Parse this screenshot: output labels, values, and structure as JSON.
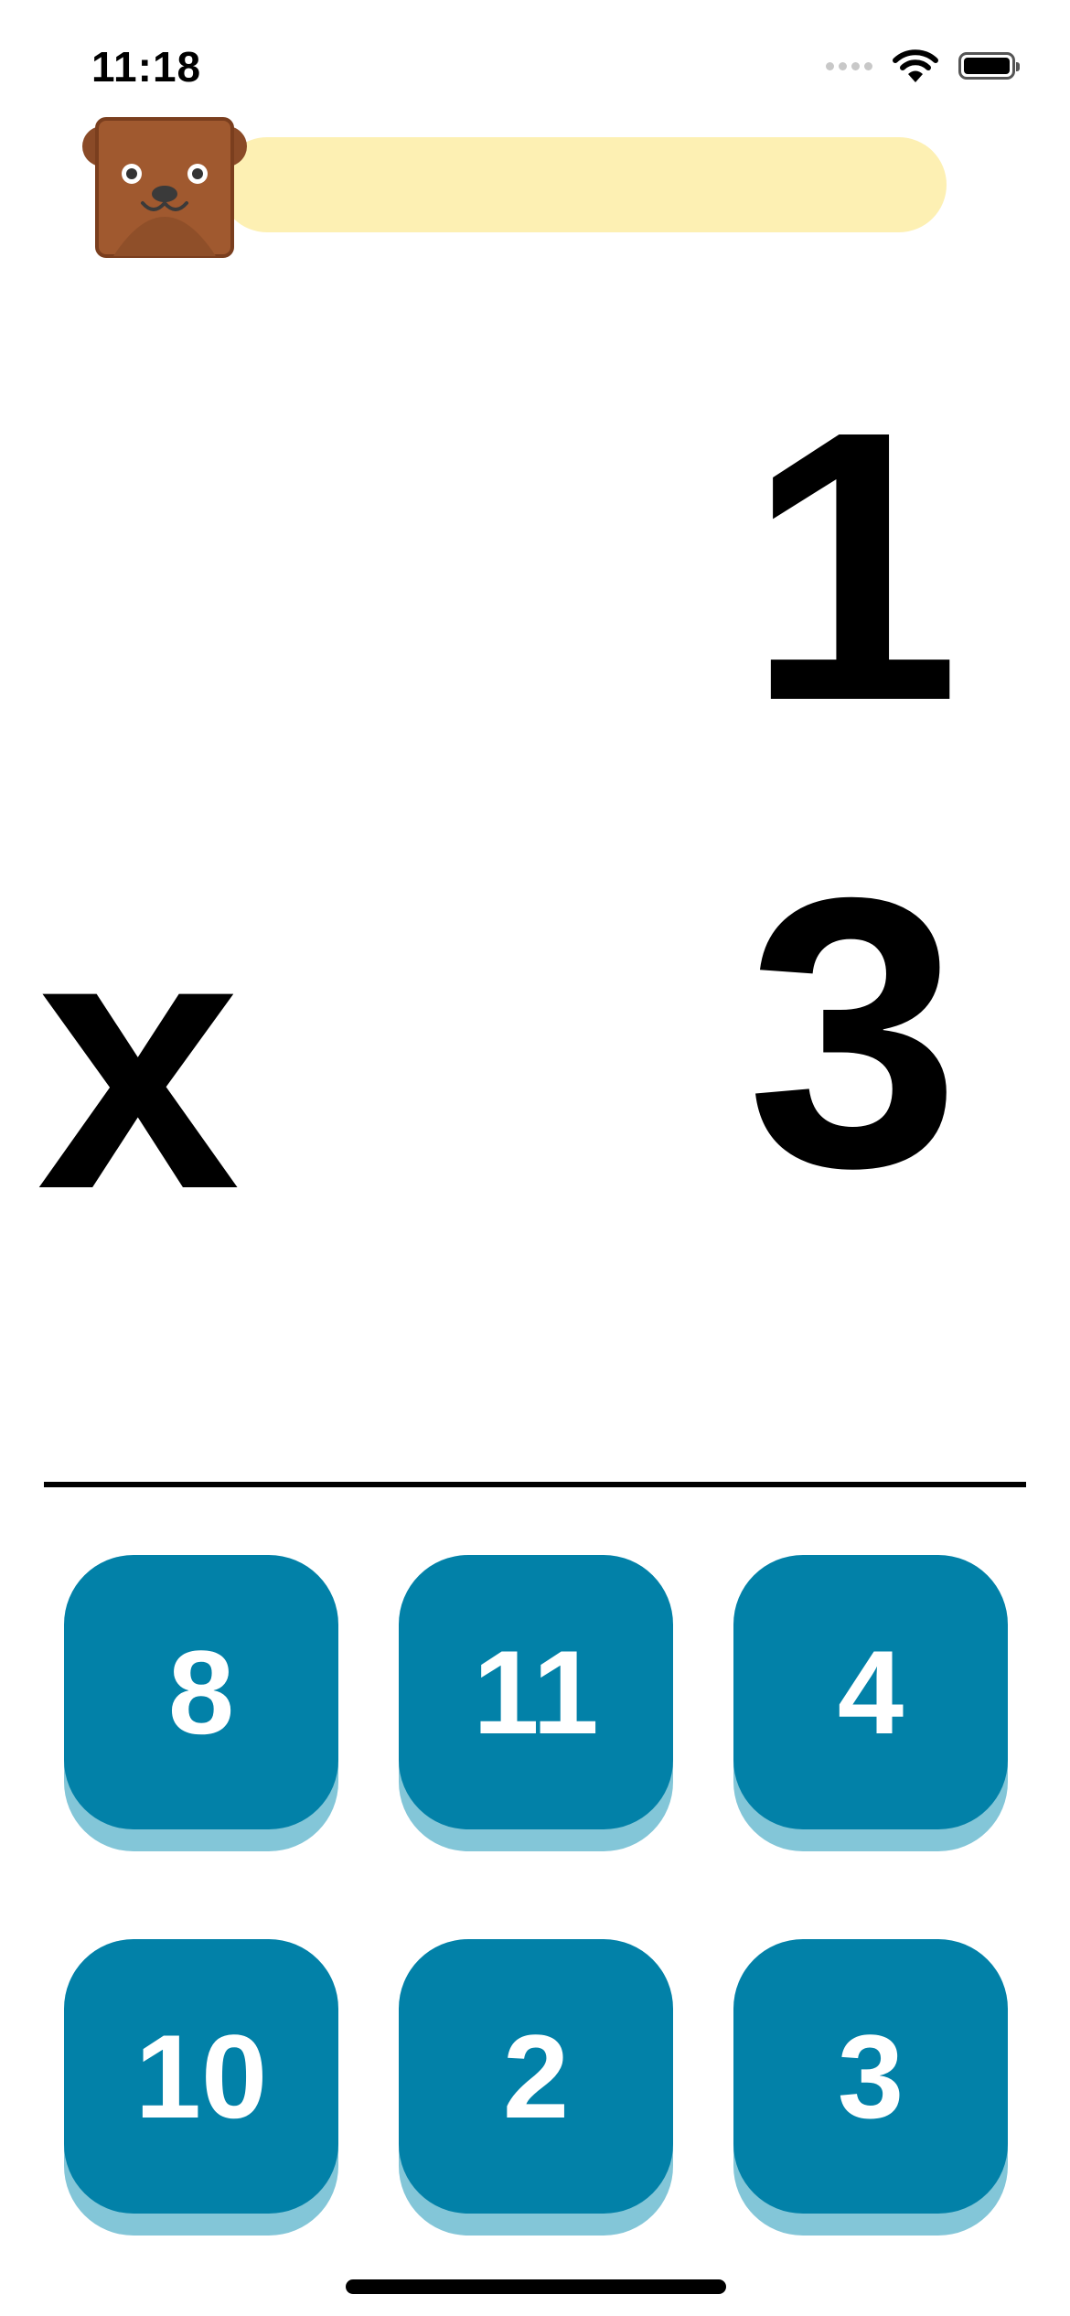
{
  "status_bar": {
    "time": "11:18",
    "icons": [
      "signal-icon",
      "wifi-icon",
      "battery-icon"
    ]
  },
  "progress": {
    "fraction": 0.0,
    "track_color": "#fdf0b3"
  },
  "avatar": {
    "icon": "bear-face-icon"
  },
  "problem": {
    "top_number": "1",
    "operator": "x",
    "bottom_number": "3"
  },
  "answers": [
    {
      "label": "8"
    },
    {
      "label": "11"
    },
    {
      "label": "4"
    },
    {
      "label": "10"
    },
    {
      "label": "2"
    },
    {
      "label": "3"
    }
  ],
  "colors": {
    "button": "#0281a8",
    "button_shadow": "#83c6d8",
    "avatar_fur": "#a0592f"
  }
}
